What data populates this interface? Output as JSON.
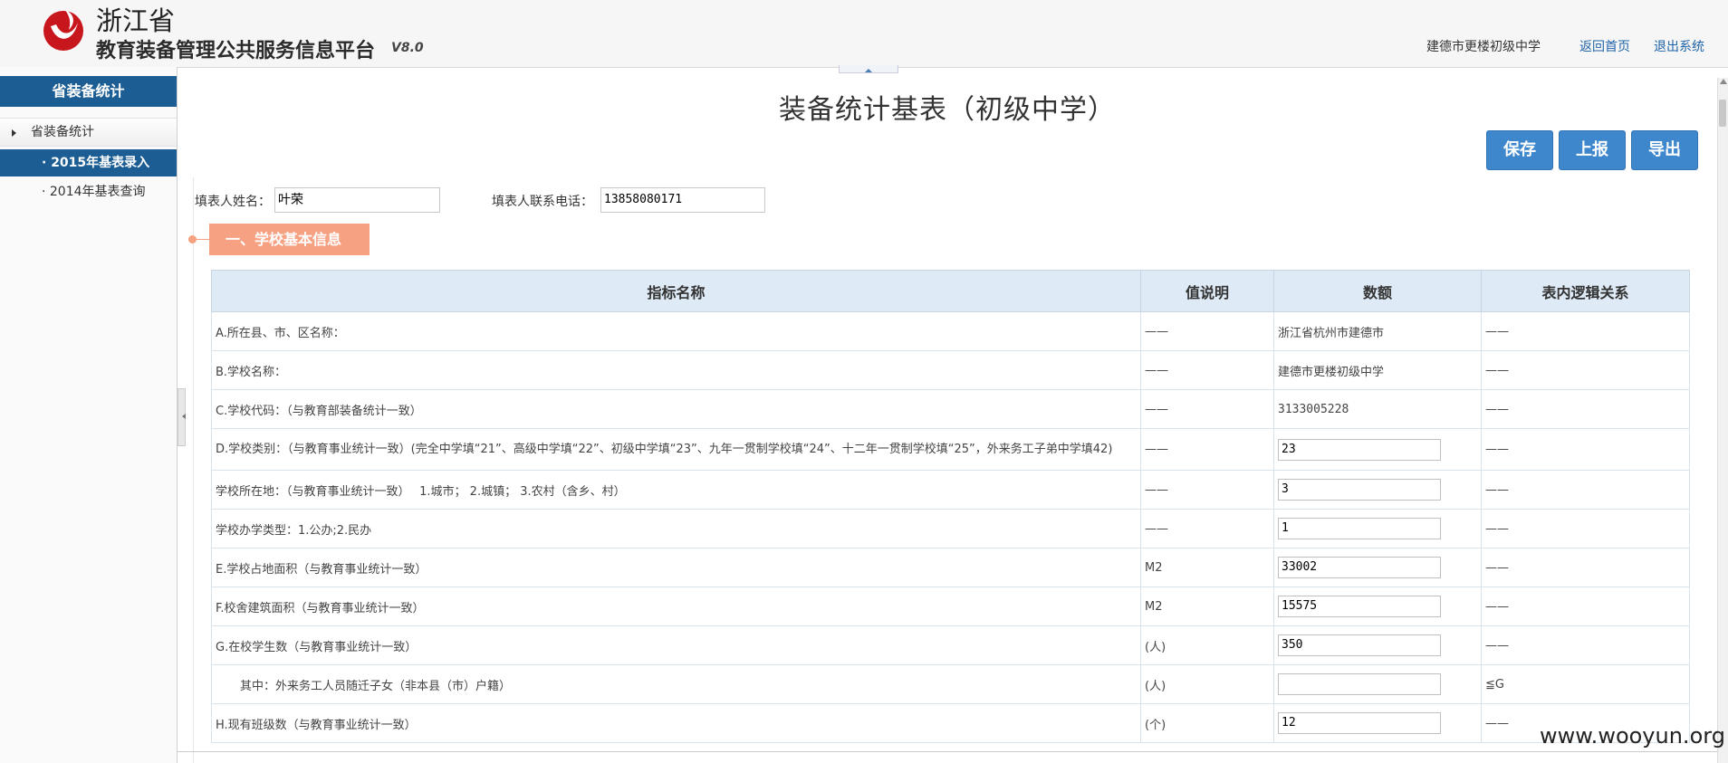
{
  "header": {
    "province": "浙江省",
    "platform": "教育装备管理公共服务信息平台",
    "version": "V8.0",
    "school": "建德市更楼初级中学",
    "home_link": "返回首页",
    "logout_link": "退出系统",
    "logo_color": "#c8161d"
  },
  "sidebar": {
    "title": "省装备统计",
    "group": "省装备统计",
    "items": [
      {
        "label": "· 2015年基表录入",
        "active": true
      },
      {
        "label": "· 2014年基表查询",
        "active": false
      }
    ],
    "accent": "#1c5d93"
  },
  "main": {
    "title": "装备统计基表（初级中学）",
    "buttons": {
      "save": "保存",
      "report": "上报",
      "export": "导出"
    },
    "form": {
      "name_label": "填表人姓名：",
      "name_value": "叶荣",
      "phone_label": "填表人联系电话：",
      "phone_value": "13858080171"
    },
    "section_title": "一、学校基本信息",
    "table": {
      "headers": [
        "指标名称",
        "值说明",
        "数额",
        "表内逻辑关系"
      ],
      "rows": [
        {
          "name": "A.所在县、市、区名称：",
          "desc": "——",
          "value": "浙江省杭州市建德市",
          "logic": "——",
          "input": false
        },
        {
          "name": "B.学校名称：",
          "desc": "——",
          "value": "建德市更楼初级中学",
          "logic": "——",
          "input": false
        },
        {
          "name": "C.学校代码：（与教育部装备统计一致）",
          "desc": "——",
          "value": "3133005228",
          "logic": "——",
          "input": false
        },
        {
          "name": "D.学校类别：（与教育事业统计一致）(完全中学填“21”、高级中学填“22”、初级中学填“23”、九年一贯制学校填“24”、十二年一贯制学校填“25”，外来务工子弟中学填42)",
          "desc": "——",
          "value": "23",
          "logic": "——",
          "input": true
        },
        {
          "name": "学校所在地：（与教育事业统计一致）　 1.城市； 2.城镇； 3.农村（含乡、村）",
          "desc": "——",
          "value": "3",
          "logic": "——",
          "input": true
        },
        {
          "name": "学校办学类型：1.公办;2.民办",
          "desc": "——",
          "value": "1",
          "logic": "——",
          "input": true
        },
        {
          "name": "E.学校占地面积（与教育事业统计一致）",
          "desc": "M2",
          "value": "33002",
          "logic": "——",
          "input": true
        },
        {
          "name": "F.校舍建筑面积（与教育事业统计一致）",
          "desc": "M2",
          "value": "15575",
          "logic": "——",
          "input": true
        },
        {
          "name": "G.在校学生数（与教育事业统计一致）",
          "desc": "(人)",
          "value": "350",
          "logic": "——",
          "input": true
        },
        {
          "name": "其中：外来务工人员随迁子女（非本县（市）户籍）",
          "desc": "(人)",
          "value": "",
          "logic": "≦G",
          "input": true,
          "indent": true
        },
        {
          "name": "H.现有班级数（与教育事业统计一致）",
          "desc": "(个)",
          "value": "12",
          "logic": "——",
          "input": true
        }
      ]
    }
  },
  "watermark": "www.wooyun.org"
}
